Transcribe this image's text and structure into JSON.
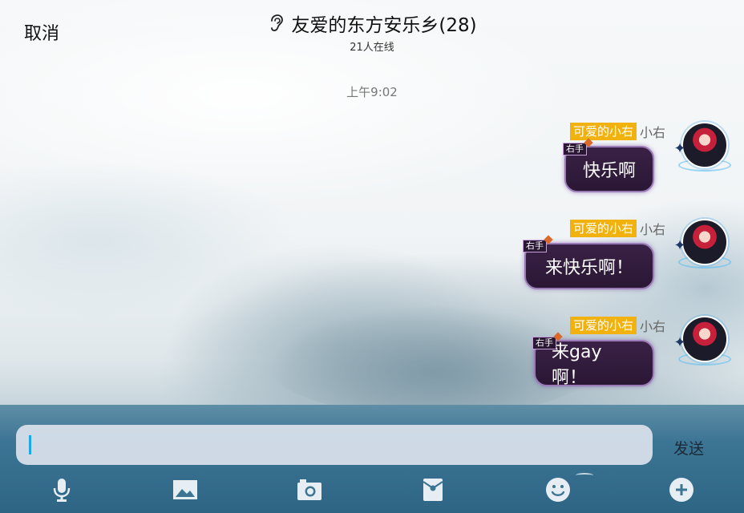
{
  "header": {
    "cancel_label": "取消",
    "title": "友爱的东方安乐乡(28)",
    "subtitle": "21人在线",
    "title_icon": "ear-icon"
  },
  "chat": {
    "timestamp": "上午9:02",
    "messages": [
      {
        "badge": "可爱的小右",
        "sender": "小右",
        "tag": "右手",
        "text": "快乐啊"
      },
      {
        "badge": "可爱的小右",
        "sender": "小右",
        "tag": "右手",
        "text": "来快乐啊！"
      },
      {
        "badge": "可爱的小右",
        "sender": "小右",
        "tag": "右手",
        "text": "来gay啊！"
      }
    ]
  },
  "composer": {
    "input_value": "",
    "send_label": "发送"
  },
  "toolbar": {
    "items": [
      "microphone-icon",
      "image-icon",
      "camera-icon",
      "red-packet-icon",
      "emoji-icon",
      "plus-icon"
    ]
  },
  "colors": {
    "badge": "#f1b20f",
    "bubble": "#2a1734",
    "bubble_border": "#9b7ab8",
    "cursor": "#1ea7e6",
    "sea": "#2e6585",
    "toolbar_icon": "#e6eef4"
  }
}
